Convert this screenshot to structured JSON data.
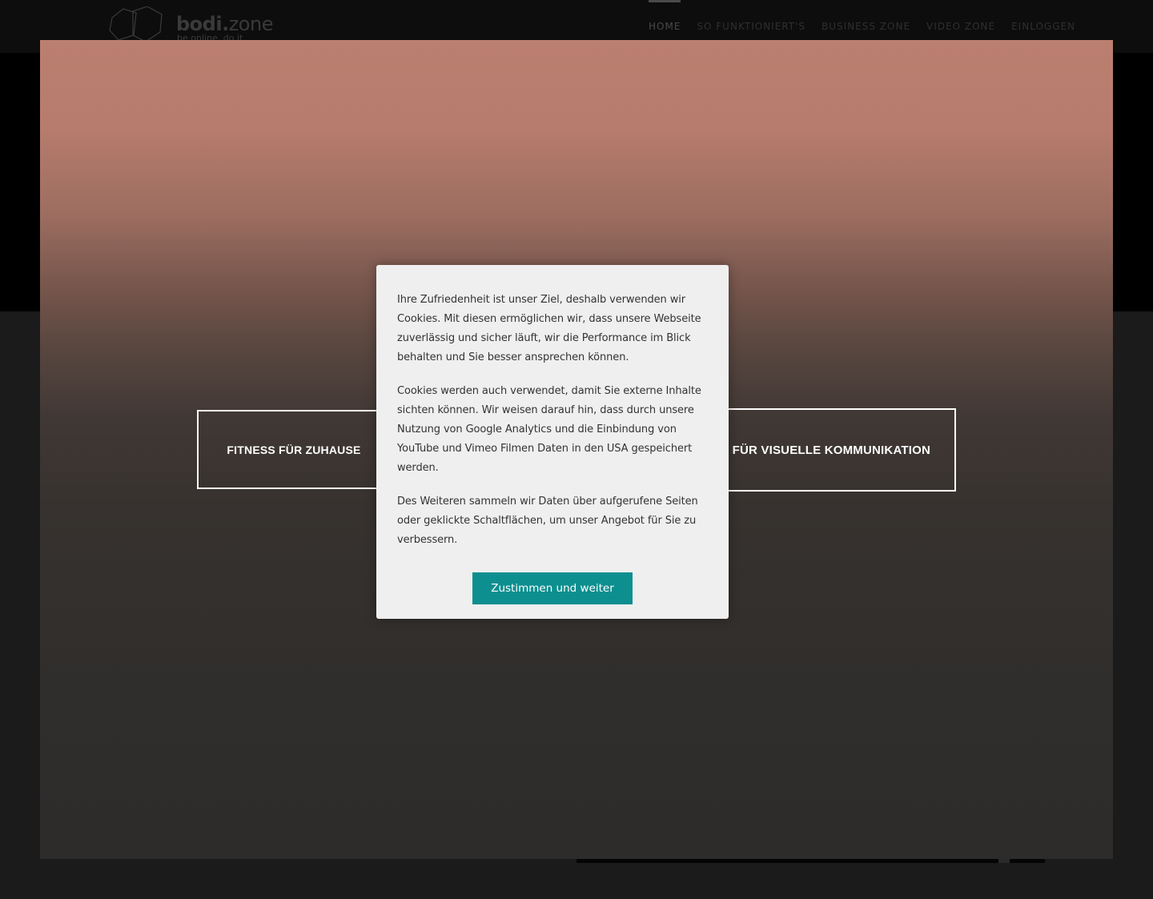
{
  "header": {
    "logo": {
      "name": "bodi",
      "dot": ".",
      "suffix": "zone",
      "tagline": "be online. do it"
    },
    "nav": [
      {
        "label": "HOME",
        "active": true
      },
      {
        "label": "SO FUNKTIONIERT'S",
        "active": false
      },
      {
        "label": "BUSINESS ZONE",
        "active": false
      },
      {
        "label": "VIDEO ZONE",
        "active": false
      },
      {
        "label": "EINLOGGEN",
        "active": false
      }
    ]
  },
  "hero": {
    "left_button": "FITNESS FÜR ZUHAUSE",
    "right_button": "DIO FÜR VISUELLE KOMMUNIKATION"
  },
  "cookie_dialog": {
    "paragraphs": [
      "Ihre Zufriedenheit ist unser Ziel, deshalb verwenden wir Cookies. Mit diesen ermöglichen wir, dass unsere Webseite zuverlässig und sicher läuft, wir die Performance im Blick behalten und Sie besser ansprechen können.",
      "Cookies werden auch verwendet, damit Sie externe Inhalte sichten können. Wir weisen darauf hin, dass durch unsere Nutzung von Google Analytics und die Einbindung von YouTube und Vimeo Filmen Daten in den USA gespeichert werden.",
      "Des Weiteren sammeln wir Daten über aufgerufene Seiten oder geklickte Schaltflächen, um unser Angebot für Sie zu verbessern."
    ],
    "accept_label": "Zustimmen und weiter"
  },
  "colors": {
    "accent": "#0d8f8f",
    "overlay_top": "#bb7f70",
    "overlay_bottom": "#2d2c2b"
  }
}
